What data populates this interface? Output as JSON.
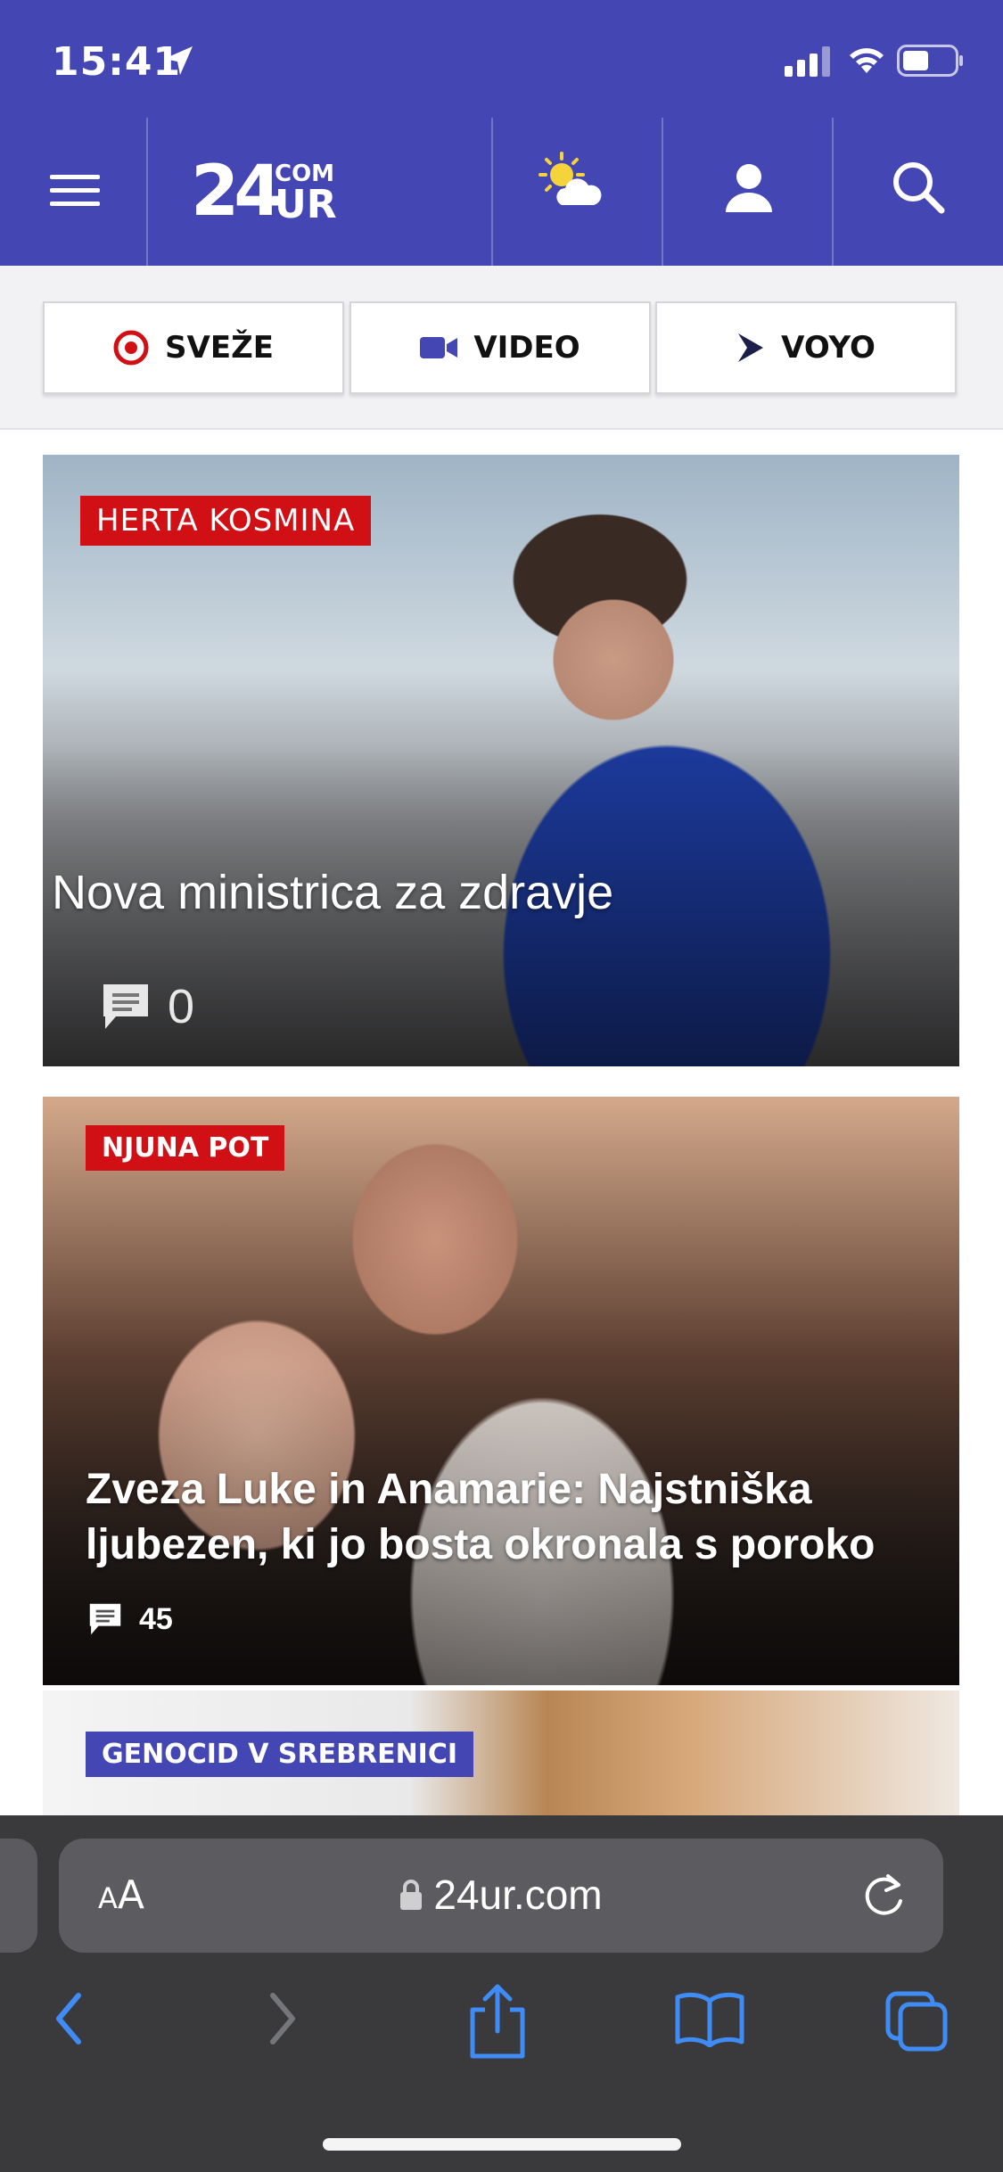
{
  "status_bar": {
    "time": "15:41"
  },
  "header": {
    "logo_main": "24",
    "logo_com": "COM",
    "logo_ur": "UR"
  },
  "tabs": [
    {
      "label": "SVEŽE",
      "icon": "target-icon"
    },
    {
      "label": "VIDEO",
      "icon": "video-camera-icon"
    },
    {
      "label": "VOYO",
      "icon": "play-arrow-icon"
    }
  ],
  "articles": [
    {
      "tag": "HERTA KOSMINA",
      "headline": "Nova ministrica za zdravje",
      "comments": "0",
      "tag_color": "#d11016"
    },
    {
      "tag": "NJUNA POT",
      "headline": "Zveza Luke in Anamarie: Najstniška ljubezen, ki jo bosta okronala s poroko",
      "comments": "45",
      "tag_color": "#d11016"
    },
    {
      "tag": "GENOCID V SREBRENICI",
      "tag_color": "#4446b3"
    }
  ],
  "browser": {
    "aa_small": "A",
    "aa_large": "A",
    "url": "24ur.com"
  },
  "colors": {
    "brand": "#4446b3",
    "accent_red": "#d11016",
    "toolbar": "#3a3a3c",
    "ios_blue": "#3f8cf6"
  }
}
